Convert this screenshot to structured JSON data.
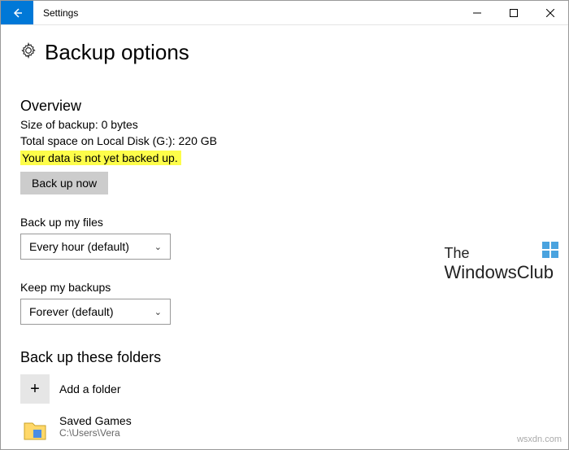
{
  "title": "Settings",
  "page_heading": "Backup options",
  "overview": {
    "heading": "Overview",
    "size": "Size of backup: 0 bytes",
    "space": "Total space on Local Disk (G:): 220 GB",
    "status": "Your data is not yet backed up.",
    "button": "Back up now"
  },
  "frequency": {
    "label": "Back up my files",
    "value": "Every hour (default)"
  },
  "keep": {
    "label": "Keep my backups",
    "value": "Forever (default)"
  },
  "folders": {
    "heading": "Back up these folders",
    "add": "Add a folder",
    "saved": {
      "name": "Saved Games",
      "path": "C:\\Users\\Vera"
    }
  },
  "watermark": {
    "top": "The",
    "bottom": "WindowsClub"
  },
  "attribution": "wsxdn.com"
}
